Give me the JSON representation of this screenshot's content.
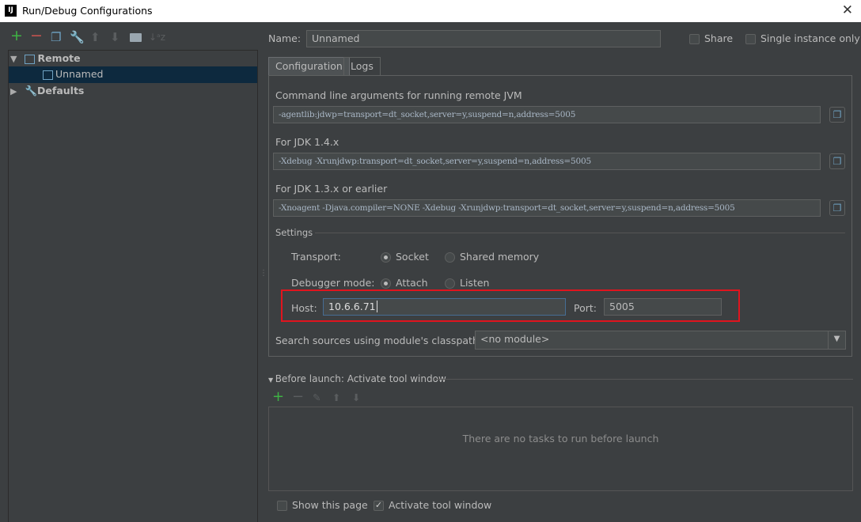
{
  "window": {
    "title": "Run/Debug Configurations",
    "logo": "IJ"
  },
  "toolbar": {
    "add": "+",
    "remove": "−",
    "copy": "copy-icon",
    "edit": "wrench-icon",
    "up": "🡅",
    "down": "🡇",
    "folder": "folder-icon",
    "sort": "↓ᵃz"
  },
  "tree": {
    "remote": "Remote",
    "unnamed": "Unnamed",
    "defaults": "Defaults"
  },
  "header": {
    "name_label": "Name:",
    "name_value": "Unnamed",
    "share": "Share",
    "single_instance": "Single instance only"
  },
  "tabs": [
    "Configuration",
    "Logs"
  ],
  "config": {
    "cmd_label": "Command line arguments for running remote JVM",
    "cmd_value": "-agentlib:jdwp=transport=dt_socket,server=y,suspend=n,address=5005",
    "jdk14_label": "For JDK 1.4.x",
    "jdk14_value": "-Xdebug -Xrunjdwp:transport=dt_socket,server=y,suspend=n,address=5005",
    "jdk13_label": "For JDK 1.3.x or earlier",
    "jdk13_value": "-Xnoagent -Djava.compiler=NONE -Xdebug -Xrunjdwp:transport=dt_socket,server=y,suspend=n,address=5005",
    "settings": "Settings",
    "transport_label": "Transport:",
    "socket": "Socket",
    "shared_memory": "Shared memory",
    "debugger_label": "Debugger mode:",
    "attach": "Attach",
    "listen": "Listen",
    "host_label": "Host:",
    "host_value": "10.6.6.71",
    "port_label": "Port:",
    "port_value": "5005",
    "search_label": "Search sources using module's classpath:",
    "module_value": "<no module>"
  },
  "before_launch": {
    "title": "Before launch: Activate tool window",
    "empty": "There are no tasks to run before launch"
  },
  "footer": {
    "show_page": "Show this page",
    "activate": "Activate tool window"
  },
  "colors": {
    "highlight": "#e0141e",
    "selection": "#0d293e"
  }
}
